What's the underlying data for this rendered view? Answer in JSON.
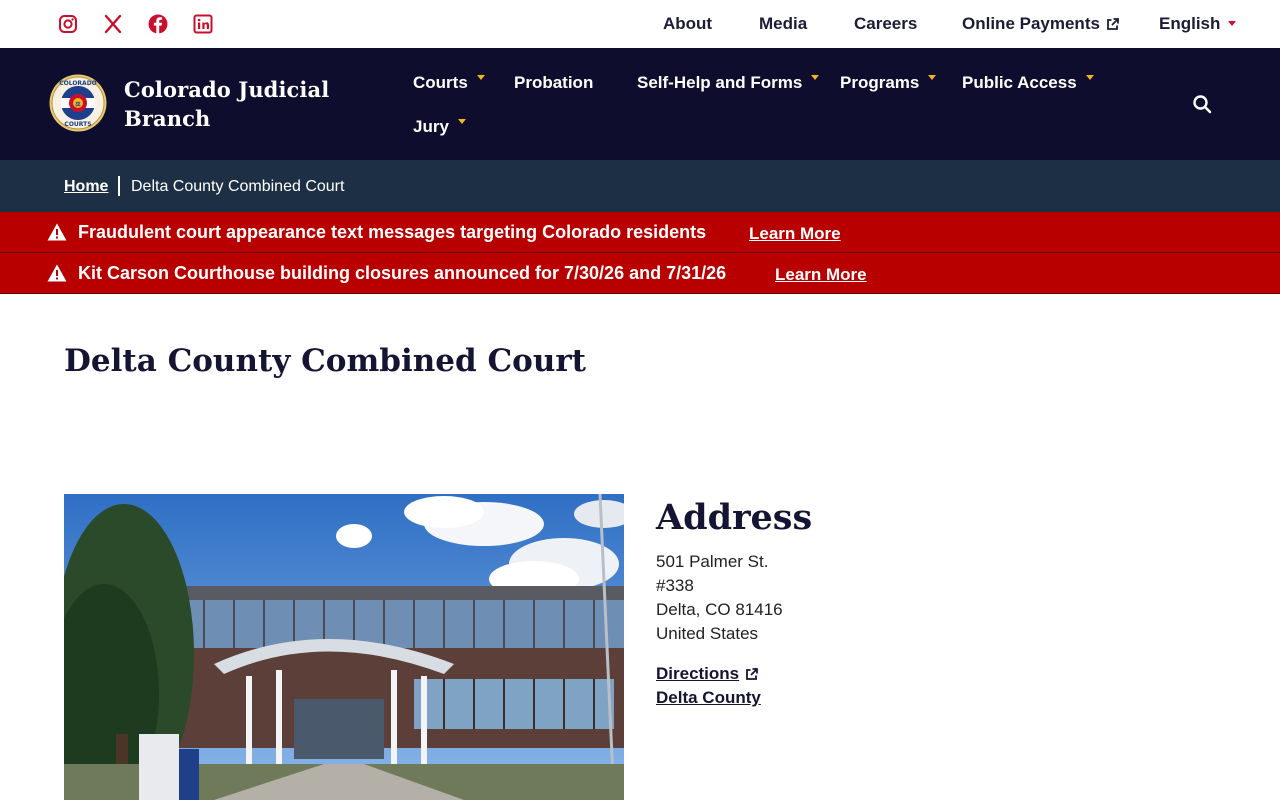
{
  "utility": {
    "social": [
      "instagram-icon",
      "x-twitter-icon",
      "facebook-icon",
      "linkedin-icon"
    ],
    "links": {
      "about": "About",
      "media": "Media",
      "careers": "Careers",
      "online_payments": "Online Payments",
      "language": "English"
    }
  },
  "header": {
    "title": "Colorado Judicial Branch",
    "seal_text_top": "COLORADO",
    "seal_text_bottom": "COURTS"
  },
  "nav": {
    "courts": "Courts",
    "probation": "Probation",
    "self_help": "Self-Help and Forms",
    "programs": "Programs",
    "public_access": "Public Access",
    "jury": "Jury"
  },
  "breadcrumb": {
    "home": "Home",
    "current": "Delta County Combined Court"
  },
  "alerts": [
    {
      "text": "Fraudulent court appearance text messages targeting Colorado residents",
      "link": "Learn More"
    },
    {
      "text": "Kit Carson Courthouse building closures announced for 7/30/26 and 7/31/26",
      "link": "Learn More"
    }
  ],
  "page": {
    "title": "Delta County Combined Court"
  },
  "address": {
    "heading": "Address",
    "line1": "501 Palmer St.",
    "line2": "#338",
    "line3": "Delta, CO 81416",
    "line4": "United States",
    "directions": "Directions",
    "county": "Delta County"
  },
  "colors": {
    "nav_bg": "#0f0d2e",
    "breadcrumb_bg": "#1d2f45",
    "alert_bg": "#b80000",
    "accent_gold": "#f2b51d",
    "accent_red": "#c8102e"
  }
}
